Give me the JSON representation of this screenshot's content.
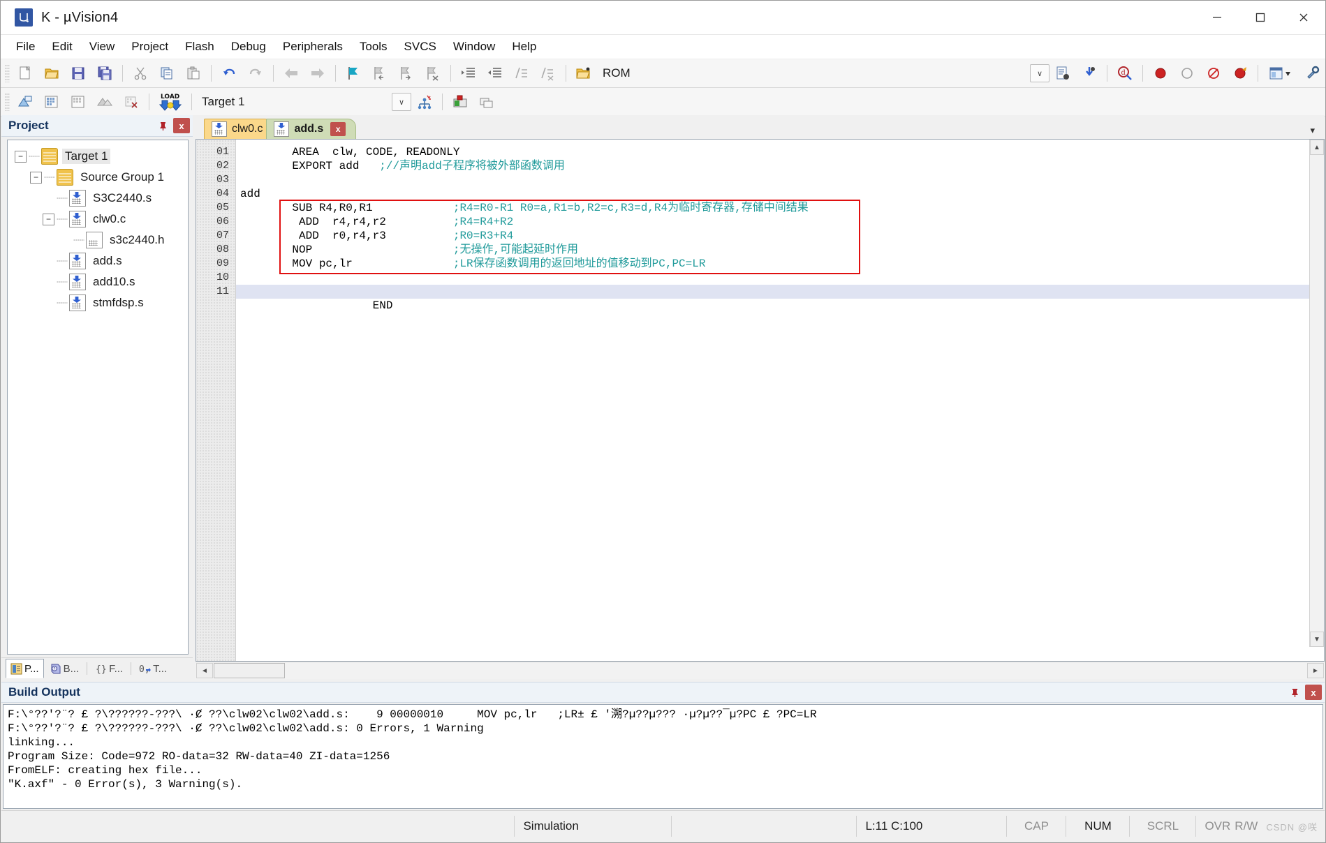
{
  "window": {
    "title": "K  - µVision4",
    "app_icon": "uvision-logo-icon",
    "minimize": "─",
    "maximize": "☐",
    "close": "✕"
  },
  "menubar": {
    "items": [
      {
        "label": "File"
      },
      {
        "label": "Edit"
      },
      {
        "label": "View"
      },
      {
        "label": "Project"
      },
      {
        "label": "Flash"
      },
      {
        "label": "Debug"
      },
      {
        "label": "Peripherals"
      },
      {
        "label": "Tools"
      },
      {
        "label": "SVCS"
      },
      {
        "label": "Window"
      },
      {
        "label": "Help"
      }
    ]
  },
  "toolbar_main": {
    "buttons": [
      {
        "name": "new-file-icon",
        "tip": "New"
      },
      {
        "name": "open-file-icon",
        "tip": "Open"
      },
      {
        "name": "save-icon",
        "tip": "Save"
      },
      {
        "name": "save-all-icon",
        "tip": "Save All"
      },
      {
        "name": "cut-icon",
        "tip": "Cut"
      },
      {
        "name": "copy-icon",
        "tip": "Copy"
      },
      {
        "name": "paste-icon",
        "tip": "Paste"
      },
      {
        "name": "undo-icon",
        "tip": "Undo"
      },
      {
        "name": "redo-icon",
        "tip": "Redo"
      },
      {
        "name": "navigate-back-icon",
        "tip": "Back"
      },
      {
        "name": "navigate-forward-icon",
        "tip": "Forward"
      },
      {
        "name": "bookmark-toggle-icon",
        "tip": "Toggle Bookmark"
      },
      {
        "name": "bookmark-prev-icon",
        "tip": "Previous Bookmark"
      },
      {
        "name": "bookmark-next-icon",
        "tip": "Next Bookmark"
      },
      {
        "name": "bookmark-clear-icon",
        "tip": "Clear Bookmarks"
      },
      {
        "name": "indent-icon",
        "tip": "Indent"
      },
      {
        "name": "outdent-icon",
        "tip": "Outdent"
      },
      {
        "name": "comment-icon",
        "tip": "Comment"
      },
      {
        "name": "uncomment-icon",
        "tip": "Uncomment"
      }
    ],
    "rom_label": "ROM",
    "rom_icon": "open-folder-icon",
    "combo_arrow": "∨",
    "right_buttons": [
      {
        "name": "insert-file-icon"
      },
      {
        "name": "configure-icon"
      },
      {
        "name": "find-in-files-icon"
      },
      {
        "name": "breakpoint-icon"
      },
      {
        "name": "breakpoint-disable-icon"
      },
      {
        "name": "kill-breakpoints-icon"
      },
      {
        "name": "disable-all-breakpoints-icon"
      },
      {
        "name": "window-layout-icon"
      },
      {
        "name": "configure-target-icon"
      }
    ]
  },
  "toolbar_build": {
    "buttons": [
      {
        "name": "translate-icon"
      },
      {
        "name": "build-icon"
      },
      {
        "name": "rebuild-icon"
      },
      {
        "name": "batch-build-icon"
      },
      {
        "name": "stop-build-icon"
      },
      {
        "name": "download-icon",
        "text": "LOAD"
      }
    ],
    "target_value": "Target 1",
    "combo_arrow": "∨",
    "after_buttons": [
      {
        "name": "target-options-icon"
      },
      {
        "name": "manage-project-items-icon"
      },
      {
        "name": "multi-project-icon"
      }
    ]
  },
  "project_panel": {
    "title": "Project",
    "pin_icon": "pin-icon",
    "close_icon": "close-icon",
    "tree": [
      {
        "label": "Target 1",
        "depth": 0,
        "icon": "folder",
        "expander": "−",
        "selected": true
      },
      {
        "label": "Source Group 1",
        "depth": 1,
        "icon": "folder",
        "expander": "−",
        "selected": false
      },
      {
        "label": "S3C2440.s",
        "depth": 2,
        "icon": "asm",
        "expander": "",
        "selected": false
      },
      {
        "label": "clw0.c",
        "depth": 2,
        "icon": "asm",
        "expander": "−",
        "selected": false
      },
      {
        "label": "s3c2440.h",
        "depth": 3,
        "icon": "doc",
        "expander": "",
        "selected": false
      },
      {
        "label": "add.s",
        "depth": 2,
        "icon": "asm",
        "expander": "",
        "selected": false
      },
      {
        "label": "add10.s",
        "depth": 2,
        "icon": "asm",
        "expander": "",
        "selected": false
      },
      {
        "label": "stmfdsp.s",
        "depth": 2,
        "icon": "asm",
        "expander": "",
        "selected": false
      }
    ],
    "bottom_tabs": [
      {
        "label": "P...",
        "icon": "project-icon",
        "active": true
      },
      {
        "label": "B...",
        "icon": "books-icon",
        "active": false
      },
      {
        "label": "F...",
        "icon": "functions-icon",
        "active": false
      },
      {
        "label": "T...",
        "icon": "templates-icon",
        "active": false
      }
    ]
  },
  "editor": {
    "tabs": [
      {
        "label": "clw0.c",
        "active": false,
        "closable": false
      },
      {
        "label": "add.s",
        "active": true,
        "closable": true
      }
    ],
    "tab_close_label": "x",
    "tabstrip_arrow": "▾",
    "scroll_up": "▲",
    "scroll_down": "▼",
    "scroll_left": "◄",
    "scroll_right": "►",
    "line_numbers": [
      "01",
      "02",
      "03",
      "04",
      "05",
      "06",
      "07",
      "08",
      "09",
      "10",
      "11"
    ],
    "lines": [
      {
        "code": "    AREA  clw, CODE, READONLY",
        "comment": "",
        "current": false
      },
      {
        "code": "    EXPORT add   ",
        "comment": ";//声明add子程序将被外部函数调用",
        "current": false
      },
      {
        "code": "",
        "comment": "",
        "current": false
      },
      {
        "code": "add",
        "comment": "",
        "current": false
      },
      {
        "code": "    SUB R4,R0,R1            ",
        "comment": ";R4=R0-R1 R0=a,R1=b,R2=c,R3=d,R4为临时寄存器,存储中间结果",
        "current": false
      },
      {
        "code": "     ADD  r4,r4,r2          ",
        "comment": ";R4=R4+R2",
        "current": false
      },
      {
        "code": "     ADD  r0,r4,r3          ",
        "comment": ";R0=R3+R4",
        "current": false
      },
      {
        "code": "    NOP                     ",
        "comment": ";无操作,可能起延时作用",
        "current": false
      },
      {
        "code": "    MOV pc,lr               ",
        "comment": ";LR保存函数调用的返回地址的值移动到PC,PC=LR",
        "current": false
      },
      {
        "code": "",
        "comment": "",
        "current": false
      },
      {
        "code": "    END",
        "comment": "",
        "current": true
      }
    ],
    "highlight_box_color": "#e01010"
  },
  "build_output": {
    "title": "Build Output",
    "pin_icon": "pin-icon",
    "close_icon": "close-icon",
    "lines": [
      "F:\\°??'?¨? £ ?\\??????-???\\ ·Ȼ ??\\clw02\\clw02\\add.s:    9 00000010     MOV pc,lr   ;LR± £ '溯?µ??µ??? ·µ?µ??¯µ?PC £ ?PC=LR",
      "F:\\°??'?¨? £ ?\\??????-???\\ ·Ȼ ??\\clw02\\clw02\\add.s: 0 Errors, 1 Warning",
      "linking...",
      "Program Size: Code=972 RO-data=32 RW-data=40 ZI-data=1256",
      "FromELF: creating hex file...",
      "\"K.axf\" - 0 Error(s), 3 Warning(s)."
    ]
  },
  "statusbar": {
    "simulation": "Simulation",
    "position": "L:11 C:100",
    "cap": "CAP",
    "num": "NUM",
    "scrl": "SCRL",
    "ovr": "OVR",
    "rw": "R/W",
    "watermark": "CSDN @咲"
  },
  "colors": {
    "accent": "#3156a3",
    "comment": "#1f9a9a",
    "tab_active": "#cfdcb6",
    "tab_inactive": "#fbd88a",
    "close_red": "#c0504d",
    "panel_title": "#14325c"
  }
}
